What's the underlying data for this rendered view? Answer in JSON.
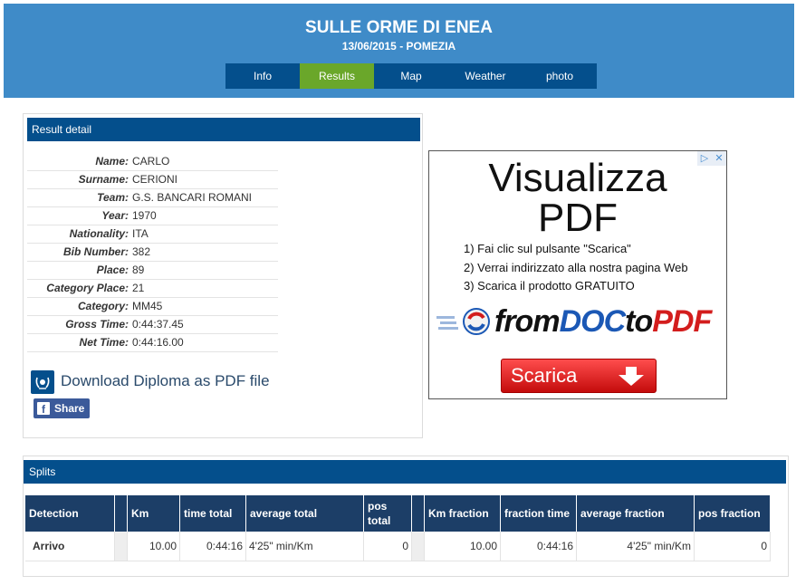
{
  "header": {
    "title": "SULLE ORME DI ENEA",
    "subtitle": "13/06/2015 - POMEZIA"
  },
  "nav": {
    "tabs": [
      {
        "label": "Info",
        "active": false
      },
      {
        "label": "Results",
        "active": true
      },
      {
        "label": "Map",
        "active": false
      },
      {
        "label": "Weather",
        "active": false
      },
      {
        "label": "photo",
        "active": false
      }
    ]
  },
  "result_detail": {
    "heading": "Result detail",
    "rows": [
      {
        "label": "Name:",
        "value": "CARLO"
      },
      {
        "label": "Surname:",
        "value": "CERIONI"
      },
      {
        "label": "Team:",
        "value": "G.S. BANCARI ROMANI"
      },
      {
        "label": "Year:",
        "value": "1970"
      },
      {
        "label": "Nationality:",
        "value": "ITA"
      },
      {
        "label": "Bib Number:",
        "value": "382"
      },
      {
        "label": "Place:",
        "value": "89"
      },
      {
        "label": "Category Place:",
        "value": "21"
      },
      {
        "label": "Category:",
        "value": "MM45"
      },
      {
        "label": "Gross Time:",
        "value": "0:44:37.45"
      },
      {
        "label": "Net Time:",
        "value": "0:44:16.00"
      }
    ],
    "diploma_link": "Download Diploma as PDF file",
    "share_label": "Share"
  },
  "ad": {
    "headline_1": "Visualizza",
    "headline_2": "PDF",
    "steps": [
      "1) Fai clic sul pulsante \"Scarica\"",
      "2) Verrai indirizzato alla nostra pagina Web",
      "3) Scarica il prodotto GRATUITO"
    ],
    "brand_from": "from",
    "brand_doc": "DOC",
    "brand_to": "to",
    "brand_pdf": "PDF",
    "button_label": "Scarica",
    "choices_icon": "adchoices-icon",
    "close_icon": "close-icon"
  },
  "splits": {
    "heading": "Splits",
    "columns": [
      "Detection",
      "Km",
      "time total",
      "average total",
      "pos total",
      "Km fraction",
      "fraction time",
      "average fraction",
      "pos fraction"
    ],
    "rows": [
      {
        "detection": "Arrivo",
        "km": "10.00",
        "time_total": "0:44:16",
        "average_total": "4'25\" min/Km",
        "pos_total": "0",
        "km_fraction": "10.00",
        "fraction_time": "0:44:16",
        "average_fraction": "4'25\" min/Km",
        "pos_fraction": "0"
      }
    ]
  },
  "colors": {
    "header_bg": "#3f8bc8",
    "nav_bg": "#044f8c",
    "nav_active": "#6aa72a",
    "panel_head": "#044f8c",
    "table_head": "#1c3e67",
    "facebook": "#3b5a9a"
  }
}
